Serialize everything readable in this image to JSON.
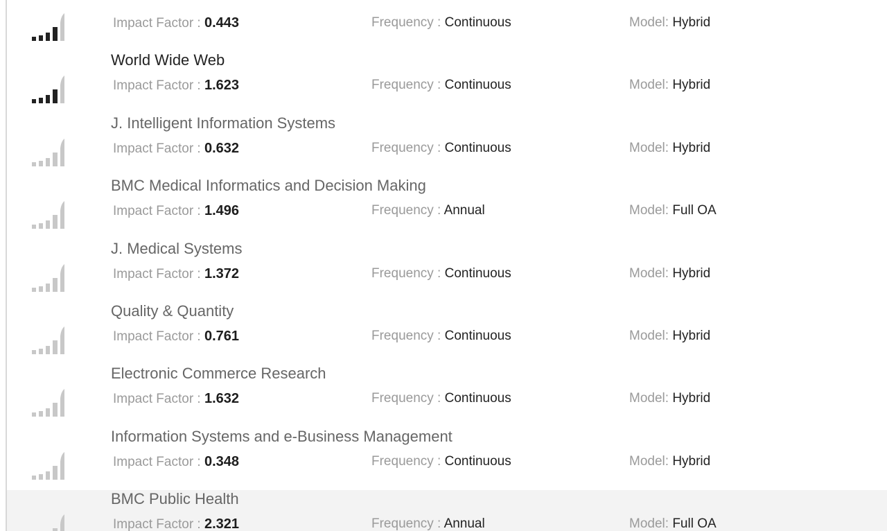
{
  "labels": {
    "impact_factor": "Impact Factor : ",
    "frequency": "Frequency : ",
    "model": "Model: "
  },
  "colors": {
    "bar_dark": "#222222",
    "bar_light": "#c8c8c8",
    "row_highlight": "#f3f3f3"
  },
  "journals": [
    {
      "title": "",
      "impact_factor": "0.443",
      "frequency": "Continuous",
      "model": "Hybrid",
      "relevance": 4,
      "title_active": false
    },
    {
      "title": "World Wide Web",
      "impact_factor": "1.623",
      "frequency": "Continuous",
      "model": "Hybrid",
      "relevance": 4,
      "title_active": true
    },
    {
      "title": "J. Intelligent Information Systems",
      "impact_factor": "0.632",
      "frequency": "Continuous",
      "model": "Hybrid",
      "relevance": 0,
      "title_active": false
    },
    {
      "title": "BMC Medical Informatics and Decision Making",
      "impact_factor": "1.496",
      "frequency": "Annual",
      "model": "Full OA",
      "relevance": 0,
      "title_active": false
    },
    {
      "title": "J. Medical Systems",
      "impact_factor": "1.372",
      "frequency": "Continuous",
      "model": "Hybrid",
      "relevance": 0,
      "title_active": false
    },
    {
      "title": "Quality & Quantity",
      "impact_factor": "0.761",
      "frequency": "Continuous",
      "model": "Hybrid",
      "relevance": 0,
      "title_active": false
    },
    {
      "title": "Electronic Commerce Research",
      "impact_factor": "1.632",
      "frequency": "Continuous",
      "model": "Hybrid",
      "relevance": 0,
      "title_active": false
    },
    {
      "title": "Information Systems and e-Business Management",
      "impact_factor": "0.348",
      "frequency": "Continuous",
      "model": "Hybrid",
      "relevance": 0,
      "title_active": false
    },
    {
      "title": "BMC Public Health",
      "impact_factor": "2.321",
      "frequency": "Annual",
      "model": "Full OA",
      "relevance": 0,
      "title_active": false,
      "highlight": true
    }
  ]
}
